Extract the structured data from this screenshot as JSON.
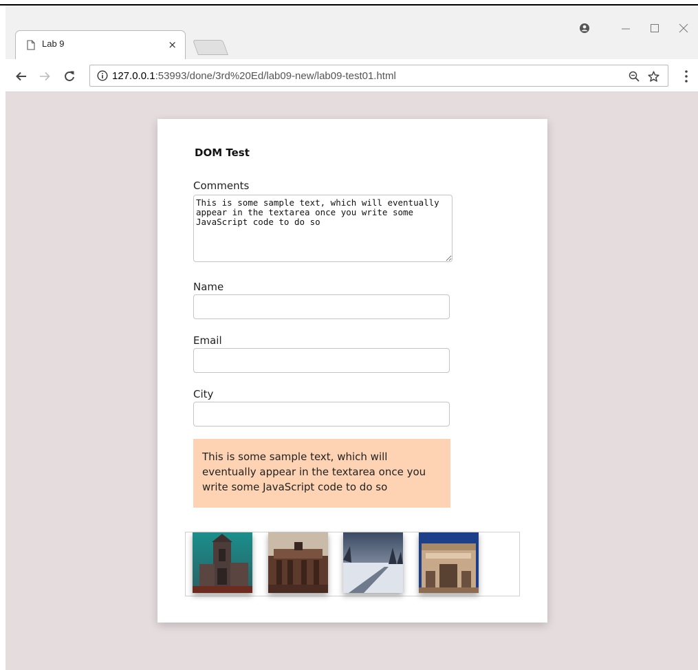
{
  "browser": {
    "tab_title": "Lab 9",
    "tab_close": "×",
    "url_host": "127.0.0.1",
    "url_rest": ":53993/done/3rd%20Ed/lab09-new/lab09-test01.html",
    "icons": [
      "page-icon",
      "profile-icon",
      "minimize-icon",
      "maximize-icon",
      "close-icon",
      "back-icon",
      "forward-icon",
      "reload-icon",
      "info-icon",
      "zoom-icon",
      "star-icon",
      "menu-icon"
    ]
  },
  "page": {
    "title": "DOM Test",
    "comments_label": "Comments",
    "comments_value": "This is some sample text, which will eventually appear in the textarea once you write some JavaScript code to do so",
    "name_label": "Name",
    "email_label": "Email",
    "city_label": "City",
    "output_text": "This is some sample text, which will eventually appear in the textarea once you write some JavaScript code to do so",
    "thumbnails": [
      "church",
      "gate",
      "snowy-road",
      "arch"
    ]
  },
  "colors": {
    "page_background": "#e5dcdd",
    "output_background": "#fdd3b4"
  }
}
